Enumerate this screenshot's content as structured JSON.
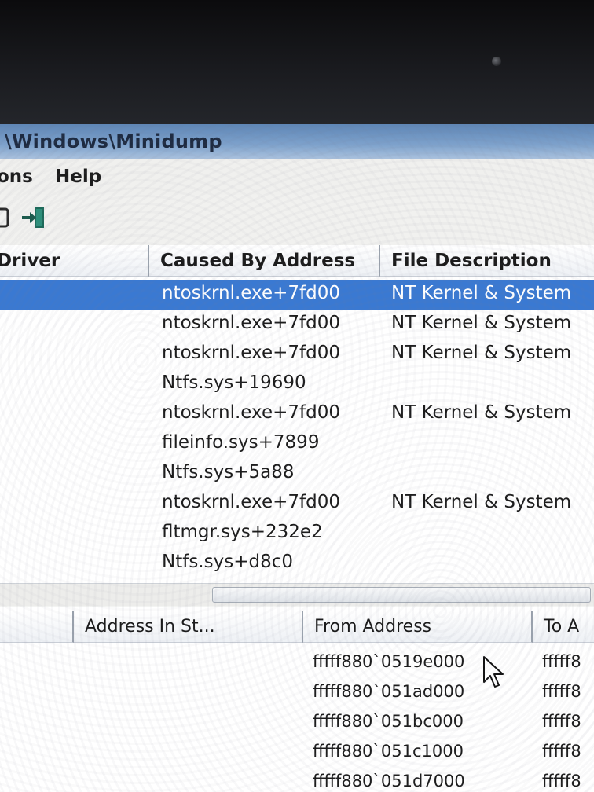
{
  "window": {
    "title": "\\Windows\\Minidump"
  },
  "menu": {
    "items": [
      "ons",
      "Help"
    ]
  },
  "upper_table": {
    "columns": [
      "Driver",
      "Caused By Address",
      "File Description"
    ],
    "rows": [
      {
        "address": "ntoskrnl.exe+7fd00",
        "description": "NT Kernel & System",
        "selected": true
      },
      {
        "address": "ntoskrnl.exe+7fd00",
        "description": "NT Kernel & System"
      },
      {
        "address": "ntoskrnl.exe+7fd00",
        "description": "NT Kernel & System"
      },
      {
        "address": "Ntfs.sys+19690",
        "description": ""
      },
      {
        "address": "ntoskrnl.exe+7fd00",
        "description": "NT Kernel & System"
      },
      {
        "address": "fileinfo.sys+7899",
        "description": ""
      },
      {
        "address": "Ntfs.sys+5a88",
        "description": ""
      },
      {
        "address": "ntoskrnl.exe+7fd00",
        "description": "NT Kernel & System"
      },
      {
        "address": "fltmgr.sys+232e2",
        "description": ""
      },
      {
        "address": "Ntfs.sys+d8c0",
        "description": ""
      }
    ]
  },
  "lower_table": {
    "columns": [
      "",
      "Address In St...",
      "From Address",
      "To A"
    ],
    "rows": [
      {
        "from": "fffff880`0519e000",
        "to": "fffff8"
      },
      {
        "from": "fffff880`051ad000",
        "to": "fffff8"
      },
      {
        "from": "fffff880`051bc000",
        "to": "fffff8"
      },
      {
        "from": "fffff880`051c1000",
        "to": "fffff8"
      },
      {
        "from": "fffff880`051d7000",
        "to": "fffff8"
      }
    ]
  },
  "colors": {
    "selection": "#3a79d2",
    "titlebar": "#7ea2cc"
  },
  "icons": {
    "toolbar": [
      "partial-icon",
      "exit-icon"
    ]
  }
}
